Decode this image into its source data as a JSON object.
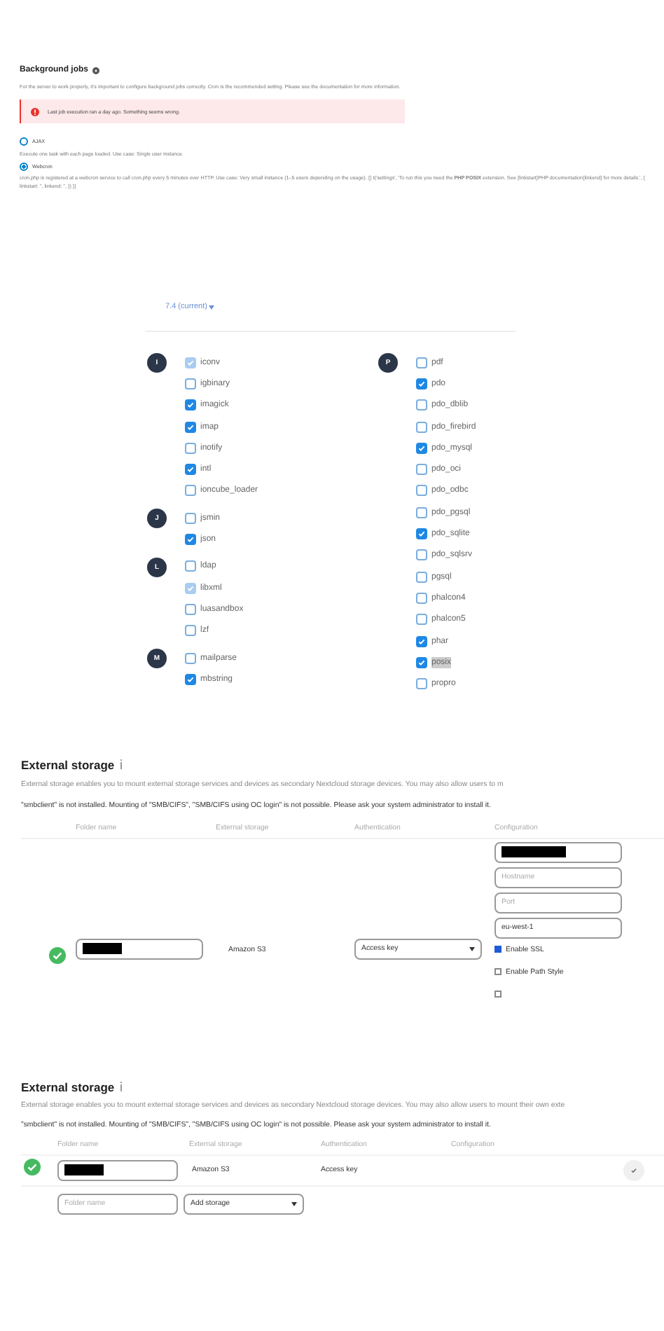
{
  "background_jobs": {
    "title": "Background jobs",
    "description": "For the server to work properly, it's important to configure background jobs correctly. Cron is the recommended setting. Please see the documentation for more information.",
    "alert": "Last job execution ran a day ago. Something seems wrong.",
    "options": [
      {
        "label": "AJAX",
        "selected": false,
        "description": "Execute one task with each page loaded. Use case: Single user instance."
      },
      {
        "label": "Webcron",
        "selected": true,
        "description": "cron.php is registered at a webcron service to call cron.php every 5 minutes over HTTP. Use case: Very small instance (1–5 users depending on the usage). {} t('settings', 'To run this you need the **PHP POSIX** extension. See {linkstart}PHP documentation{linkend} for more details.', { linkstart: '', linkend: '', }) }}"
      }
    ]
  },
  "php_version": "7.4 (current)",
  "extension_columns": [
    [
      {
        "letter": "I",
        "items": [
          {
            "name": "iconv",
            "checked": true,
            "disabled": true
          },
          {
            "name": "igbinary",
            "checked": false,
            "disabled": false
          },
          {
            "name": "imagick",
            "checked": true,
            "disabled": false
          },
          {
            "name": "imap",
            "checked": true,
            "disabled": false
          },
          {
            "name": "inotify",
            "checked": false,
            "disabled": false
          },
          {
            "name": "intl",
            "checked": true,
            "disabled": false
          },
          {
            "name": "ioncube_loader",
            "checked": false,
            "disabled": false
          }
        ]
      },
      {
        "letter": "J",
        "items": [
          {
            "name": "jsmin",
            "checked": false,
            "disabled": false
          },
          {
            "name": "json",
            "checked": true,
            "disabled": false
          }
        ]
      },
      {
        "letter": "L",
        "items": [
          {
            "name": "ldap",
            "checked": false,
            "disabled": false
          },
          {
            "name": "libxml",
            "checked": true,
            "disabled": true
          },
          {
            "name": "luasandbox",
            "checked": false,
            "disabled": false
          },
          {
            "name": "lzf",
            "checked": false,
            "disabled": false
          }
        ]
      },
      {
        "letter": "M",
        "items": [
          {
            "name": "mailparse",
            "checked": false,
            "disabled": false
          },
          {
            "name": "mbstring",
            "checked": true,
            "disabled": false
          }
        ]
      }
    ],
    [
      {
        "letter": "P",
        "items": [
          {
            "name": "pdf",
            "checked": false,
            "disabled": false
          },
          {
            "name": "pdo",
            "checked": true,
            "disabled": false
          },
          {
            "name": "pdo_dblib",
            "checked": false,
            "disabled": false
          },
          {
            "name": "pdo_firebird",
            "checked": false,
            "disabled": false
          },
          {
            "name": "pdo_mysql",
            "checked": true,
            "disabled": false
          },
          {
            "name": "pdo_oci",
            "checked": false,
            "disabled": false
          },
          {
            "name": "pdo_odbc",
            "checked": false,
            "disabled": false
          },
          {
            "name": "pdo_pgsql",
            "checked": false,
            "disabled": false
          },
          {
            "name": "pdo_sqlite",
            "checked": true,
            "disabled": false
          },
          {
            "name": "pdo_sqlsrv",
            "checked": false,
            "disabled": false
          },
          {
            "name": "pgsql",
            "checked": false,
            "disabled": false
          },
          {
            "name": "phalcon4",
            "checked": false,
            "disabled": false
          },
          {
            "name": "phalcon5",
            "checked": false,
            "disabled": false
          },
          {
            "name": "phar",
            "checked": true,
            "disabled": false
          },
          {
            "name": "posix",
            "checked": true,
            "disabled": false,
            "selected": true
          },
          {
            "name": "propro",
            "checked": false,
            "disabled": false
          }
        ]
      }
    ]
  ],
  "external_storage_edit": {
    "title": "External storage",
    "description": "External storage enables you to mount external storage services and devices as secondary Nextcloud storage devices. You may also allow users to m",
    "warning": "\"smbclient\" is not installed. Mounting of \"SMB/CIFS\", \"SMB/CIFS using OC login\" is not possible. Please ask your system administrator to install it.",
    "columns": [
      "Folder name",
      "External storage",
      "Authentication",
      "Configuration"
    ],
    "row": {
      "storage": "Amazon S3",
      "authentication": "Access key",
      "config_fields": [
        {
          "redacted": true
        },
        {
          "placeholder": "Hostname"
        },
        {
          "placeholder": "Port"
        },
        {
          "value": "eu-west-1"
        }
      ],
      "options": [
        {
          "label": "Enable SSL",
          "checked": true
        },
        {
          "label": "Enable Path Style",
          "checked": false
        },
        {
          "checked": false
        }
      ]
    }
  },
  "external_storage_view": {
    "title": "External storage",
    "description": "External storage enables you to mount external storage services and devices as secondary Nextcloud storage devices. You may also allow users to mount their own exte",
    "warning": "\"smbclient\" is not installed. Mounting of \"SMB/CIFS\", \"SMB/CIFS using OC login\" is not possible. Please ask your system administrator to install it.",
    "columns": [
      "Folder name",
      "External storage",
      "Authentication",
      "Configuration"
    ],
    "row": {
      "storage": "Amazon S3",
      "authentication": "Access key"
    },
    "new_row": {
      "placeholder": "Folder name",
      "select": "Add storage"
    }
  }
}
